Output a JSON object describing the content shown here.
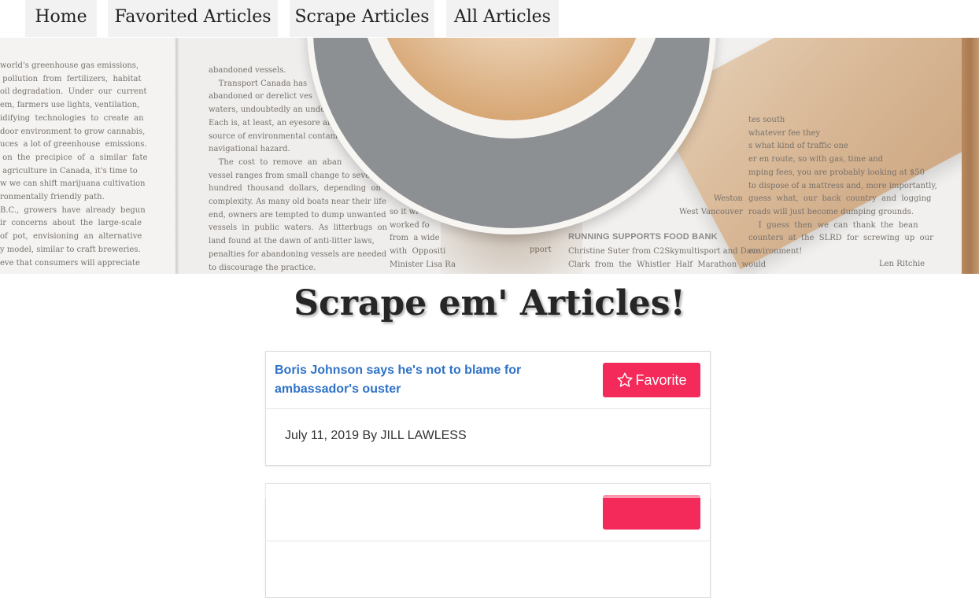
{
  "nav": {
    "items": [
      {
        "label": "Home"
      },
      {
        "label": "Favorited Articles"
      },
      {
        "label": "Scrape Articles"
      },
      {
        "label": "All Articles"
      }
    ]
  },
  "hero": {
    "left_col": "world's greenhouse gas emissions,\n pollution  from  fertilizers,  habitat\noil degradation.  Under  our  current\nem, farmers use lights, ventilation,\nidifying  technologies  to  create  an\ndoor environment to grow cannabis,\nuces  a lot of greenhouse  emissions.\n on  the  precipice  of  a  similar  fate\n agriculture in Canada, it's time to\nw we can shift marijuana cultivation\nronmentally friendly path.\nB.C.,  growers  have  already  begun\nir  concerns  about  the  large-scale\nof  pot,  envisioning  an  alternative\ny model, similar to craft breweries.\neve that consumers will appreciate",
    "mid_col": "abandoned vessels.\n    Transport Canada has\nabandoned or derelict ves\nwaters, undoubtedly an under\nEach is, at least, an eyesore ar\nsource of environmental contamin\nnavigational hazard.\n    The  cost  to  remove  an  aban\nvessel ranges from small change to seve\nhundred  thousand  dollars,  depending  on\ncomplexity. As many old boats near their life\nend, owners are tempted to dump unwanted\nvessels  in  public  waters.  As  litterbugs  on\nland found at the dawn of anti-litter laws,\npenalties for abandoning vessels are needed\nto discourage the practice.",
    "mid2_col": "so it wi\nworked fo\nfrom  a wide\nwith  Oppositi\nMinister Lisa Ra",
    "mid2_extra": "pport",
    "right_col_a": "Weston\nWest Vancouver",
    "right_headline": "RUNNING SUPPORTS FOOD BANK",
    "right_col_b": "Christine Suter from C2Skymultisport and Dave\nClark  from  the  Whistler  Half  Marathon  would",
    "far_right_col": "tes south\nwhatever fee they\ns what kind of traffic one\ner en route, so with gas, time and\nmping fees, you are probably looking at $50\nto dispose of a mattress and, more importantly,\nguess  what,  our  back  country  and  logging\nroads will just become dumping grounds.\n    I  guess  then  we  can  thank  the  bean\ncounters  at  the  SLRD  for  screwing  up  our\nenvironment!",
    "signature": "Len Ritchie"
  },
  "page_title": "Scrape em' Articles!",
  "articles": [
    {
      "title": "Boris Johnson says he's not to blame for ambassador's ouster",
      "meta": "July 11, 2019 By JILL LAWLESS",
      "favorite_label": "Favorite"
    },
    {
      "title": "",
      "meta": "",
      "favorite_label": ""
    }
  ],
  "colors": {
    "accent": "#f32a5a",
    "link": "#2f72c8",
    "nav_tab_bg": "#f2f2f2"
  },
  "icons": {
    "favorite": "star-outline-icon"
  }
}
